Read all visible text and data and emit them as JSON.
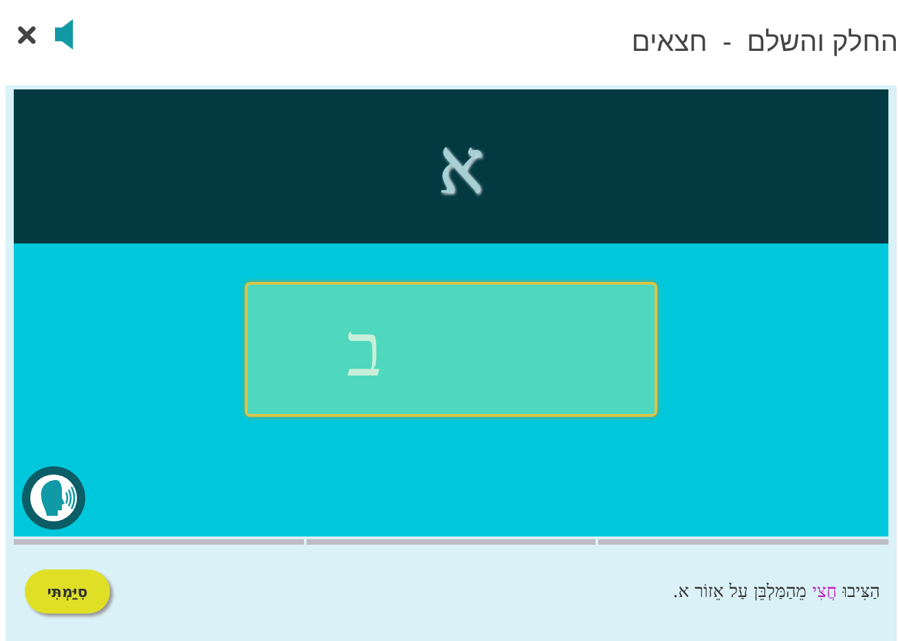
{
  "window": {
    "title": "החלק והשלם  -  חצאים"
  },
  "target_zone": {
    "letter": "א"
  },
  "card": {
    "letter": "ב"
  },
  "progress_segments": [
    {
      "done": false
    },
    {
      "done": false
    },
    {
      "done": false
    }
  ],
  "instruction": {
    "parts": [
      {
        "text": "הַצִּיבוּ ",
        "highlight": false
      },
      {
        "text": "חֲצִי",
        "highlight": true
      },
      {
        "text": " מֵהַמַּלְבֵּן עַל אֵזוֹר א.",
        "highlight": false
      }
    ]
  },
  "buttons": [
    {
      "label": "סִיַּמְתִּי"
    }
  ]
}
